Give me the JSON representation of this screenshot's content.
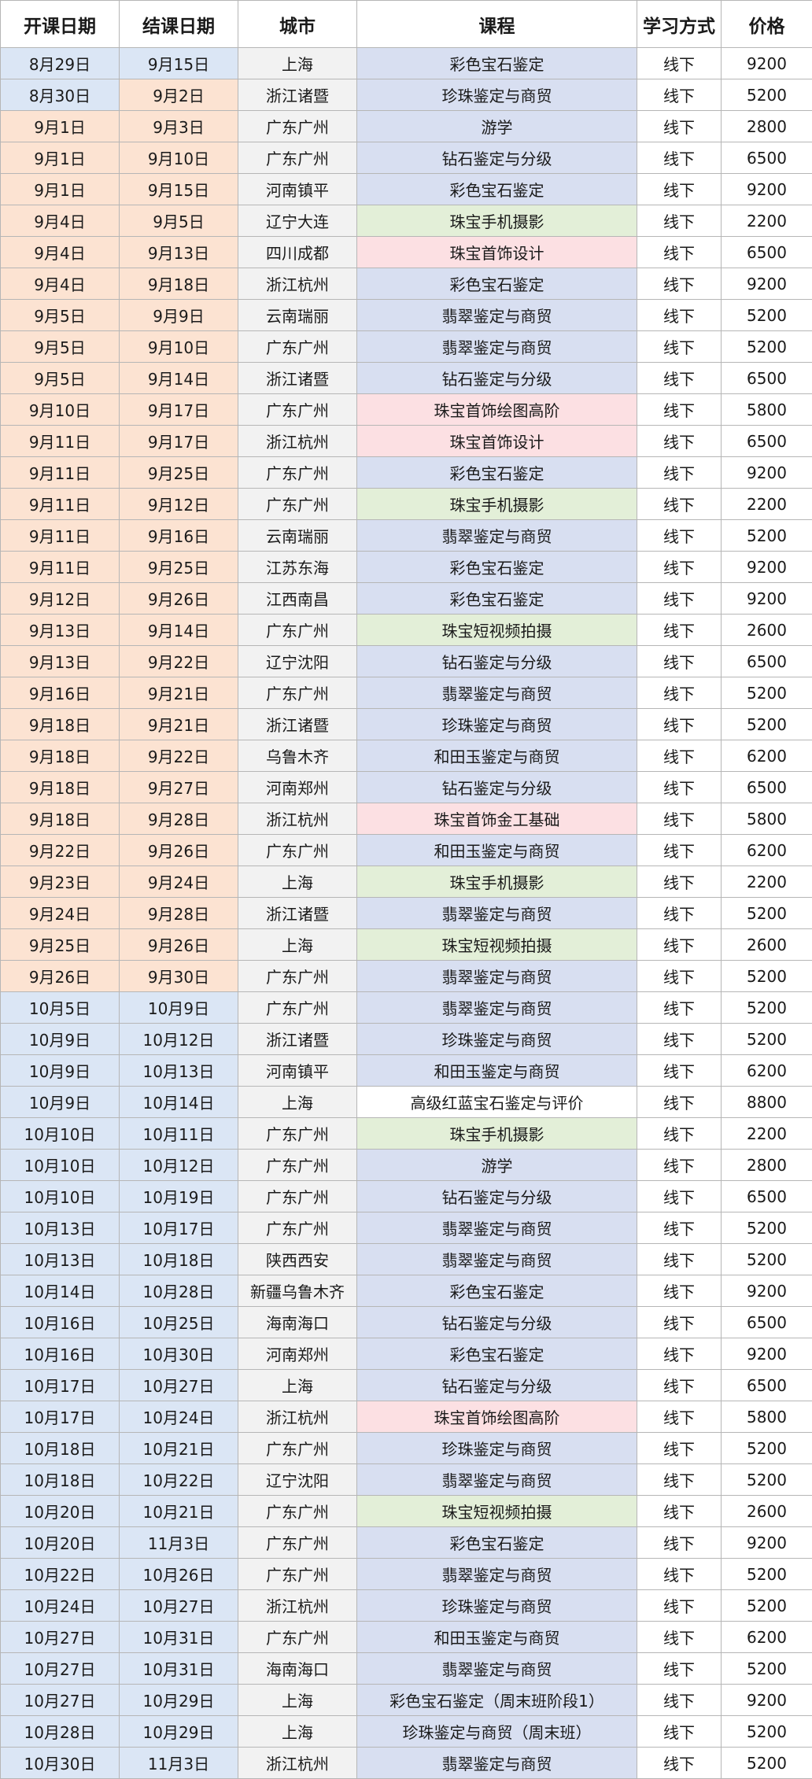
{
  "headers": [
    "开课日期",
    "结课日期",
    "城市",
    "课程",
    "学习方式",
    "价格"
  ],
  "rows": [
    [
      "8月29日",
      "9月15日",
      "上海",
      "彩色宝石鉴定",
      "线下",
      "9200"
    ],
    [
      "8月30日",
      "9月2日",
      "浙江诸暨",
      "珍珠鉴定与商贸",
      "线下",
      "5200"
    ],
    [
      "9月1日",
      "9月3日",
      "广东广州",
      "游学",
      "线下",
      "2800"
    ],
    [
      "9月1日",
      "9月10日",
      "广东广州",
      "钻石鉴定与分级",
      "线下",
      "6500"
    ],
    [
      "9月1日",
      "9月15日",
      "河南镇平",
      "彩色宝石鉴定",
      "线下",
      "9200"
    ],
    [
      "9月4日",
      "9月5日",
      "辽宁大连",
      "珠宝手机摄影",
      "线下",
      "2200"
    ],
    [
      "9月4日",
      "9月13日",
      "四川成都",
      "珠宝首饰设计",
      "线下",
      "6500"
    ],
    [
      "9月4日",
      "9月18日",
      "浙江杭州",
      "彩色宝石鉴定",
      "线下",
      "9200"
    ],
    [
      "9月5日",
      "9月9日",
      "云南瑞丽",
      "翡翠鉴定与商贸",
      "线下",
      "5200"
    ],
    [
      "9月5日",
      "9月10日",
      "广东广州",
      "翡翠鉴定与商贸",
      "线下",
      "5200"
    ],
    [
      "9月5日",
      "9月14日",
      "浙江诸暨",
      "钻石鉴定与分级",
      "线下",
      "6500"
    ],
    [
      "9月10日",
      "9月17日",
      "广东广州",
      "珠宝首饰绘图高阶",
      "线下",
      "5800"
    ],
    [
      "9月11日",
      "9月17日",
      "浙江杭州",
      "珠宝首饰设计",
      "线下",
      "6500"
    ],
    [
      "9月11日",
      "9月25日",
      "广东广州",
      "彩色宝石鉴定",
      "线下",
      "9200"
    ],
    [
      "9月11日",
      "9月12日",
      "广东广州",
      "珠宝手机摄影",
      "线下",
      "2200"
    ],
    [
      "9月11日",
      "9月16日",
      "云南瑞丽",
      "翡翠鉴定与商贸",
      "线下",
      "5200"
    ],
    [
      "9月11日",
      "9月25日",
      "江苏东海",
      "彩色宝石鉴定",
      "线下",
      "9200"
    ],
    [
      "9月12日",
      "9月26日",
      "江西南昌",
      "彩色宝石鉴定",
      "线下",
      "9200"
    ],
    [
      "9月13日",
      "9月14日",
      "广东广州",
      "珠宝短视频拍摄",
      "线下",
      "2600"
    ],
    [
      "9月13日",
      "9月22日",
      "辽宁沈阳",
      "钻石鉴定与分级",
      "线下",
      "6500"
    ],
    [
      "9月16日",
      "9月21日",
      "广东广州",
      "翡翠鉴定与商贸",
      "线下",
      "5200"
    ],
    [
      "9月18日",
      "9月21日",
      "浙江诸暨",
      "珍珠鉴定与商贸",
      "线下",
      "5200"
    ],
    [
      "9月18日",
      "9月22日",
      "乌鲁木齐",
      "和田玉鉴定与商贸",
      "线下",
      "6200"
    ],
    [
      "9月18日",
      "9月27日",
      "河南郑州",
      "钻石鉴定与分级",
      "线下",
      "6500"
    ],
    [
      "9月18日",
      "9月28日",
      "浙江杭州",
      "珠宝首饰金工基础",
      "线下",
      "5800"
    ],
    [
      "9月22日",
      "9月26日",
      "广东广州",
      "和田玉鉴定与商贸",
      "线下",
      "6200"
    ],
    [
      "9月23日",
      "9月24日",
      "上海",
      "珠宝手机摄影",
      "线下",
      "2200"
    ],
    [
      "9月24日",
      "9月28日",
      "浙江诸暨",
      "翡翠鉴定与商贸",
      "线下",
      "5200"
    ],
    [
      "9月25日",
      "9月26日",
      "上海",
      "珠宝短视频拍摄",
      "线下",
      "2600"
    ],
    [
      "9月26日",
      "9月30日",
      "广东广州",
      "翡翠鉴定与商贸",
      "线下",
      "5200"
    ],
    [
      "10月5日",
      "10月9日",
      "广东广州",
      "翡翠鉴定与商贸",
      "线下",
      "5200"
    ],
    [
      "10月9日",
      "10月12日",
      "浙江诸暨",
      "珍珠鉴定与商贸",
      "线下",
      "5200"
    ],
    [
      "10月9日",
      "10月13日",
      "河南镇平",
      "和田玉鉴定与商贸",
      "线下",
      "6200"
    ],
    [
      "10月9日",
      "10月14日",
      "上海",
      "高级红蓝宝石鉴定与评价",
      "线下",
      "8800"
    ],
    [
      "10月10日",
      "10月11日",
      "广东广州",
      "珠宝手机摄影",
      "线下",
      "2200"
    ],
    [
      "10月10日",
      "10月12日",
      "广东广州",
      "游学",
      "线下",
      "2800"
    ],
    [
      "10月10日",
      "10月19日",
      "广东广州",
      "钻石鉴定与分级",
      "线下",
      "6500"
    ],
    [
      "10月13日",
      "10月17日",
      "广东广州",
      "翡翠鉴定与商贸",
      "线下",
      "5200"
    ],
    [
      "10月13日",
      "10月18日",
      "陕西西安",
      "翡翠鉴定与商贸",
      "线下",
      "5200"
    ],
    [
      "10月14日",
      "10月28日",
      "新疆乌鲁木齐",
      "彩色宝石鉴定",
      "线下",
      "9200"
    ],
    [
      "10月16日",
      "10月25日",
      "海南海口",
      "钻石鉴定与分级",
      "线下",
      "6500"
    ],
    [
      "10月16日",
      "10月30日",
      "河南郑州",
      "彩色宝石鉴定",
      "线下",
      "9200"
    ],
    [
      "10月17日",
      "10月27日",
      "上海",
      "钻石鉴定与分级",
      "线下",
      "6500"
    ],
    [
      "10月17日",
      "10月24日",
      "浙江杭州",
      "珠宝首饰绘图高阶",
      "线下",
      "5800"
    ],
    [
      "10月18日",
      "10月21日",
      "广东广州",
      "珍珠鉴定与商贸",
      "线下",
      "5200"
    ],
    [
      "10月18日",
      "10月22日",
      "辽宁沈阳",
      "翡翠鉴定与商贸",
      "线下",
      "5200"
    ],
    [
      "10月20日",
      "10月21日",
      "广东广州",
      "珠宝短视频拍摄",
      "线下",
      "2600"
    ],
    [
      "10月20日",
      "11月3日",
      "广东广州",
      "彩色宝石鉴定",
      "线下",
      "9200"
    ],
    [
      "10月22日",
      "10月26日",
      "广东广州",
      "翡翠鉴定与商贸",
      "线下",
      "5200"
    ],
    [
      "10月24日",
      "10月27日",
      "浙江杭州",
      "珍珠鉴定与商贸",
      "线下",
      "5200"
    ],
    [
      "10月27日",
      "10月31日",
      "广东广州",
      "和田玉鉴定与商贸",
      "线下",
      "6200"
    ],
    [
      "10月27日",
      "10月31日",
      "海南海口",
      "翡翠鉴定与商贸",
      "线下",
      "5200"
    ],
    [
      "10月27日",
      "10月29日",
      "上海",
      "彩色宝石鉴定（周末班阶段1）",
      "线下",
      "9200"
    ],
    [
      "10月28日",
      "10月29日",
      "上海",
      "珍珠鉴定与商贸（周末班）",
      "线下",
      "5200"
    ],
    [
      "10月30日",
      "11月3日",
      "浙江杭州",
      "翡翠鉴定与商贸",
      "线下",
      "5200"
    ]
  ],
  "colors": {
    "start_fill": [
      "blue",
      "blue",
      "peach",
      "peach",
      "peach",
      "peach",
      "peach",
      "peach",
      "peach",
      "peach",
      "peach",
      "peach",
      "peach",
      "peach",
      "peach",
      "peach",
      "peach",
      "peach",
      "peach",
      "peach",
      "peach",
      "peach",
      "peach",
      "peach",
      "peach",
      "peach",
      "peach",
      "peach",
      "peach",
      "peach",
      "blue",
      "blue",
      "blue",
      "blue",
      "blue",
      "blue",
      "blue",
      "blue",
      "blue",
      "blue",
      "blue",
      "blue",
      "blue",
      "blue",
      "blue",
      "blue",
      "blue",
      "blue",
      "blue",
      "blue",
      "blue",
      "blue",
      "blue",
      "blue",
      "blue"
    ],
    "end_fill": [
      "blue",
      "peach",
      "peach",
      "peach",
      "peach",
      "peach",
      "peach",
      "peach",
      "peach",
      "peach",
      "peach",
      "peach",
      "peach",
      "peach",
      "peach",
      "peach",
      "peach",
      "peach",
      "peach",
      "peach",
      "peach",
      "peach",
      "peach",
      "peach",
      "peach",
      "peach",
      "peach",
      "peach",
      "peach",
      "peach",
      "blue",
      "blue",
      "blue",
      "blue",
      "blue",
      "blue",
      "blue",
      "blue",
      "blue",
      "blue",
      "blue",
      "blue",
      "blue",
      "blue",
      "blue",
      "blue",
      "blue",
      "blue",
      "blue",
      "blue",
      "blue",
      "blue",
      "blue",
      "blue",
      "blue"
    ],
    "course_fill": [
      "lav",
      "lav",
      "lav",
      "lav",
      "lav",
      "green",
      "pink",
      "lav",
      "lav",
      "lav",
      "lav",
      "pink",
      "pink",
      "lav",
      "green",
      "lav",
      "lav",
      "lav",
      "green",
      "lav",
      "lav",
      "lav",
      "lav",
      "lav",
      "pink",
      "lav",
      "green",
      "lav",
      "green",
      "lav",
      "lav",
      "lav",
      "lav",
      "white",
      "green",
      "lav",
      "lav",
      "lav",
      "lav",
      "lav",
      "lav",
      "lav",
      "lav",
      "pink",
      "lav",
      "lav",
      "green",
      "lav",
      "lav",
      "lav",
      "lav",
      "lav",
      "lav",
      "lav",
      "lav"
    ],
    "palette": {
      "blue": "#dbe6f5",
      "peach": "#fce3d2",
      "gray": "#f2f2f2",
      "lav": "#d8dff1",
      "pink": "#fce0e3",
      "green": "#e3efd8",
      "white": "#ffffff"
    }
  }
}
